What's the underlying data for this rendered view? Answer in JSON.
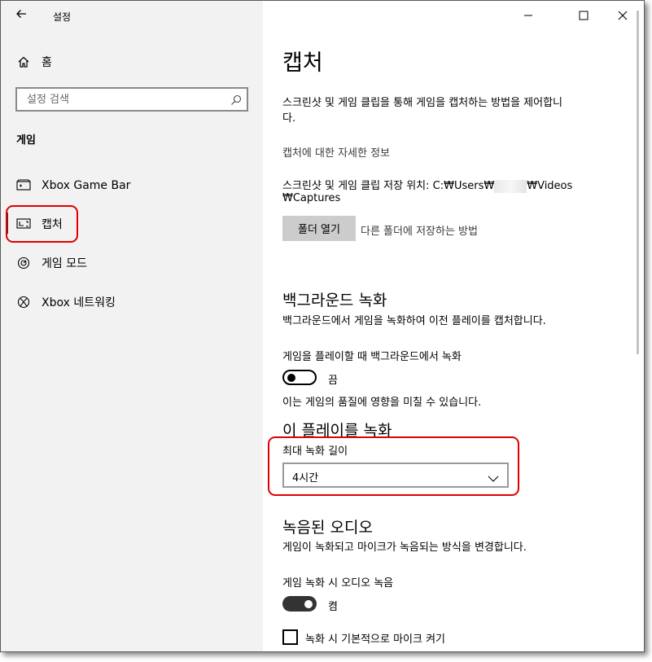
{
  "window": {
    "title": "설정",
    "controls": {
      "minimize": "—",
      "maximize": "☐",
      "close": "✕"
    }
  },
  "sidebar": {
    "home_label": "홈",
    "search_placeholder": "설정 검색",
    "section_header": "게임",
    "items": [
      {
        "label": "Xbox Game Bar",
        "icon": "game-bar-icon"
      },
      {
        "label": "캡처",
        "icon": "capture-icon",
        "selected": true
      },
      {
        "label": "게임 모드",
        "icon": "game-mode-icon"
      },
      {
        "label": "Xbox 네트워킹",
        "icon": "xbox-icon"
      }
    ]
  },
  "main": {
    "title": "캡처",
    "description_line1": "스크린샷 및 게임 클립을 통해 게임을 캡처하는 방법을 제어합니",
    "description_line2": "다.",
    "more_info_link": "캡처에 대한 자세한 정보",
    "save_location_line1_prefix": "스크린샷 및 게임 클립 저장 위치: C:₩Users₩",
    "save_location_line1_suffix": "₩Videos",
    "save_location_line2": "₩Captures",
    "open_folder_button": "폴더 열기",
    "other_folder_link": "다른 폴더에 저장하는 방법",
    "background": {
      "heading": "백그라운드 녹화",
      "description": "백그라운드에서 게임을 녹화하여 이전 플레이를 캡처합니다.",
      "toggle_label": "게임을 플레이할 때 백그라운드에서 녹화",
      "toggle_state": "끔",
      "note": "이는 게임의 품질에 영향을 미칠 수 있습니다."
    },
    "record_this": {
      "heading": "이 플레이를 녹화",
      "max_length_label": "최대 녹화 길이",
      "max_length_value": "4시간"
    },
    "audio": {
      "heading": "녹음된 오디오",
      "description": "게임이 녹화되고 마이크가 녹음되는 방식을 변경합니다.",
      "toggle_label": "게임 녹화 시 오디오 녹음",
      "toggle_state": "켬",
      "mic_checkbox_label": "녹화 시 기본적으로 마이크 켜기"
    }
  },
  "colors": {
    "highlight": "#e00000",
    "sidebar_bg": "#f2f2f2",
    "button_bg": "#cccccc"
  }
}
